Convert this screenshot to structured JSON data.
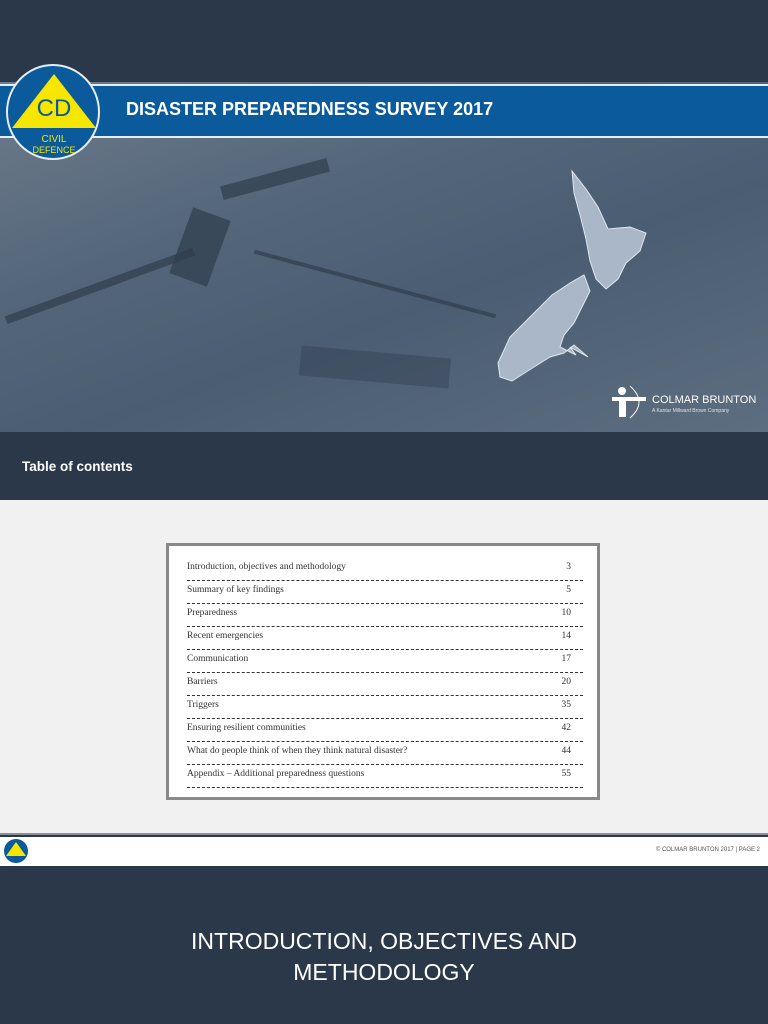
{
  "header": {
    "title": "DISASTER PREPAREDNESS SURVEY 2017",
    "logo_text": {
      "initials": "CD",
      "top": "CIVIL",
      "bottom": "DEFENCE"
    }
  },
  "brand": {
    "name": "COLMAR BRUNTON",
    "tagline": "A Kantar Millward Brown Company"
  },
  "toc": {
    "heading": "Table of contents",
    "items": [
      {
        "title": "Introduction, objectives and methodology",
        "page": "3"
      },
      {
        "title": "Summary of key findings",
        "page": "5"
      },
      {
        "title": "Preparedness",
        "page": "10"
      },
      {
        "title": "Recent emergencies",
        "page": "14"
      },
      {
        "title": "Communication",
        "page": "17"
      },
      {
        "title": "Barriers",
        "page": "20"
      },
      {
        "title": "Triggers",
        "page": "35"
      },
      {
        "title": "Ensuring resilient communities",
        "page": "42"
      },
      {
        "title": "What do people think of when they think natural disaster?",
        "page": "44"
      },
      {
        "title": "Appendix – Additional preparedness questions",
        "page": "55"
      }
    ]
  },
  "footer": {
    "copyright": "© COLMAR BRUNTON 2017 | PAGE 2"
  },
  "section": {
    "heading": "INTRODUCTION, OBJECTIVES AND METHODOLOGY"
  },
  "colors": {
    "banner": "#0a5a9c",
    "dark": "#2a3849",
    "logo_yellow": "#f7e600"
  }
}
